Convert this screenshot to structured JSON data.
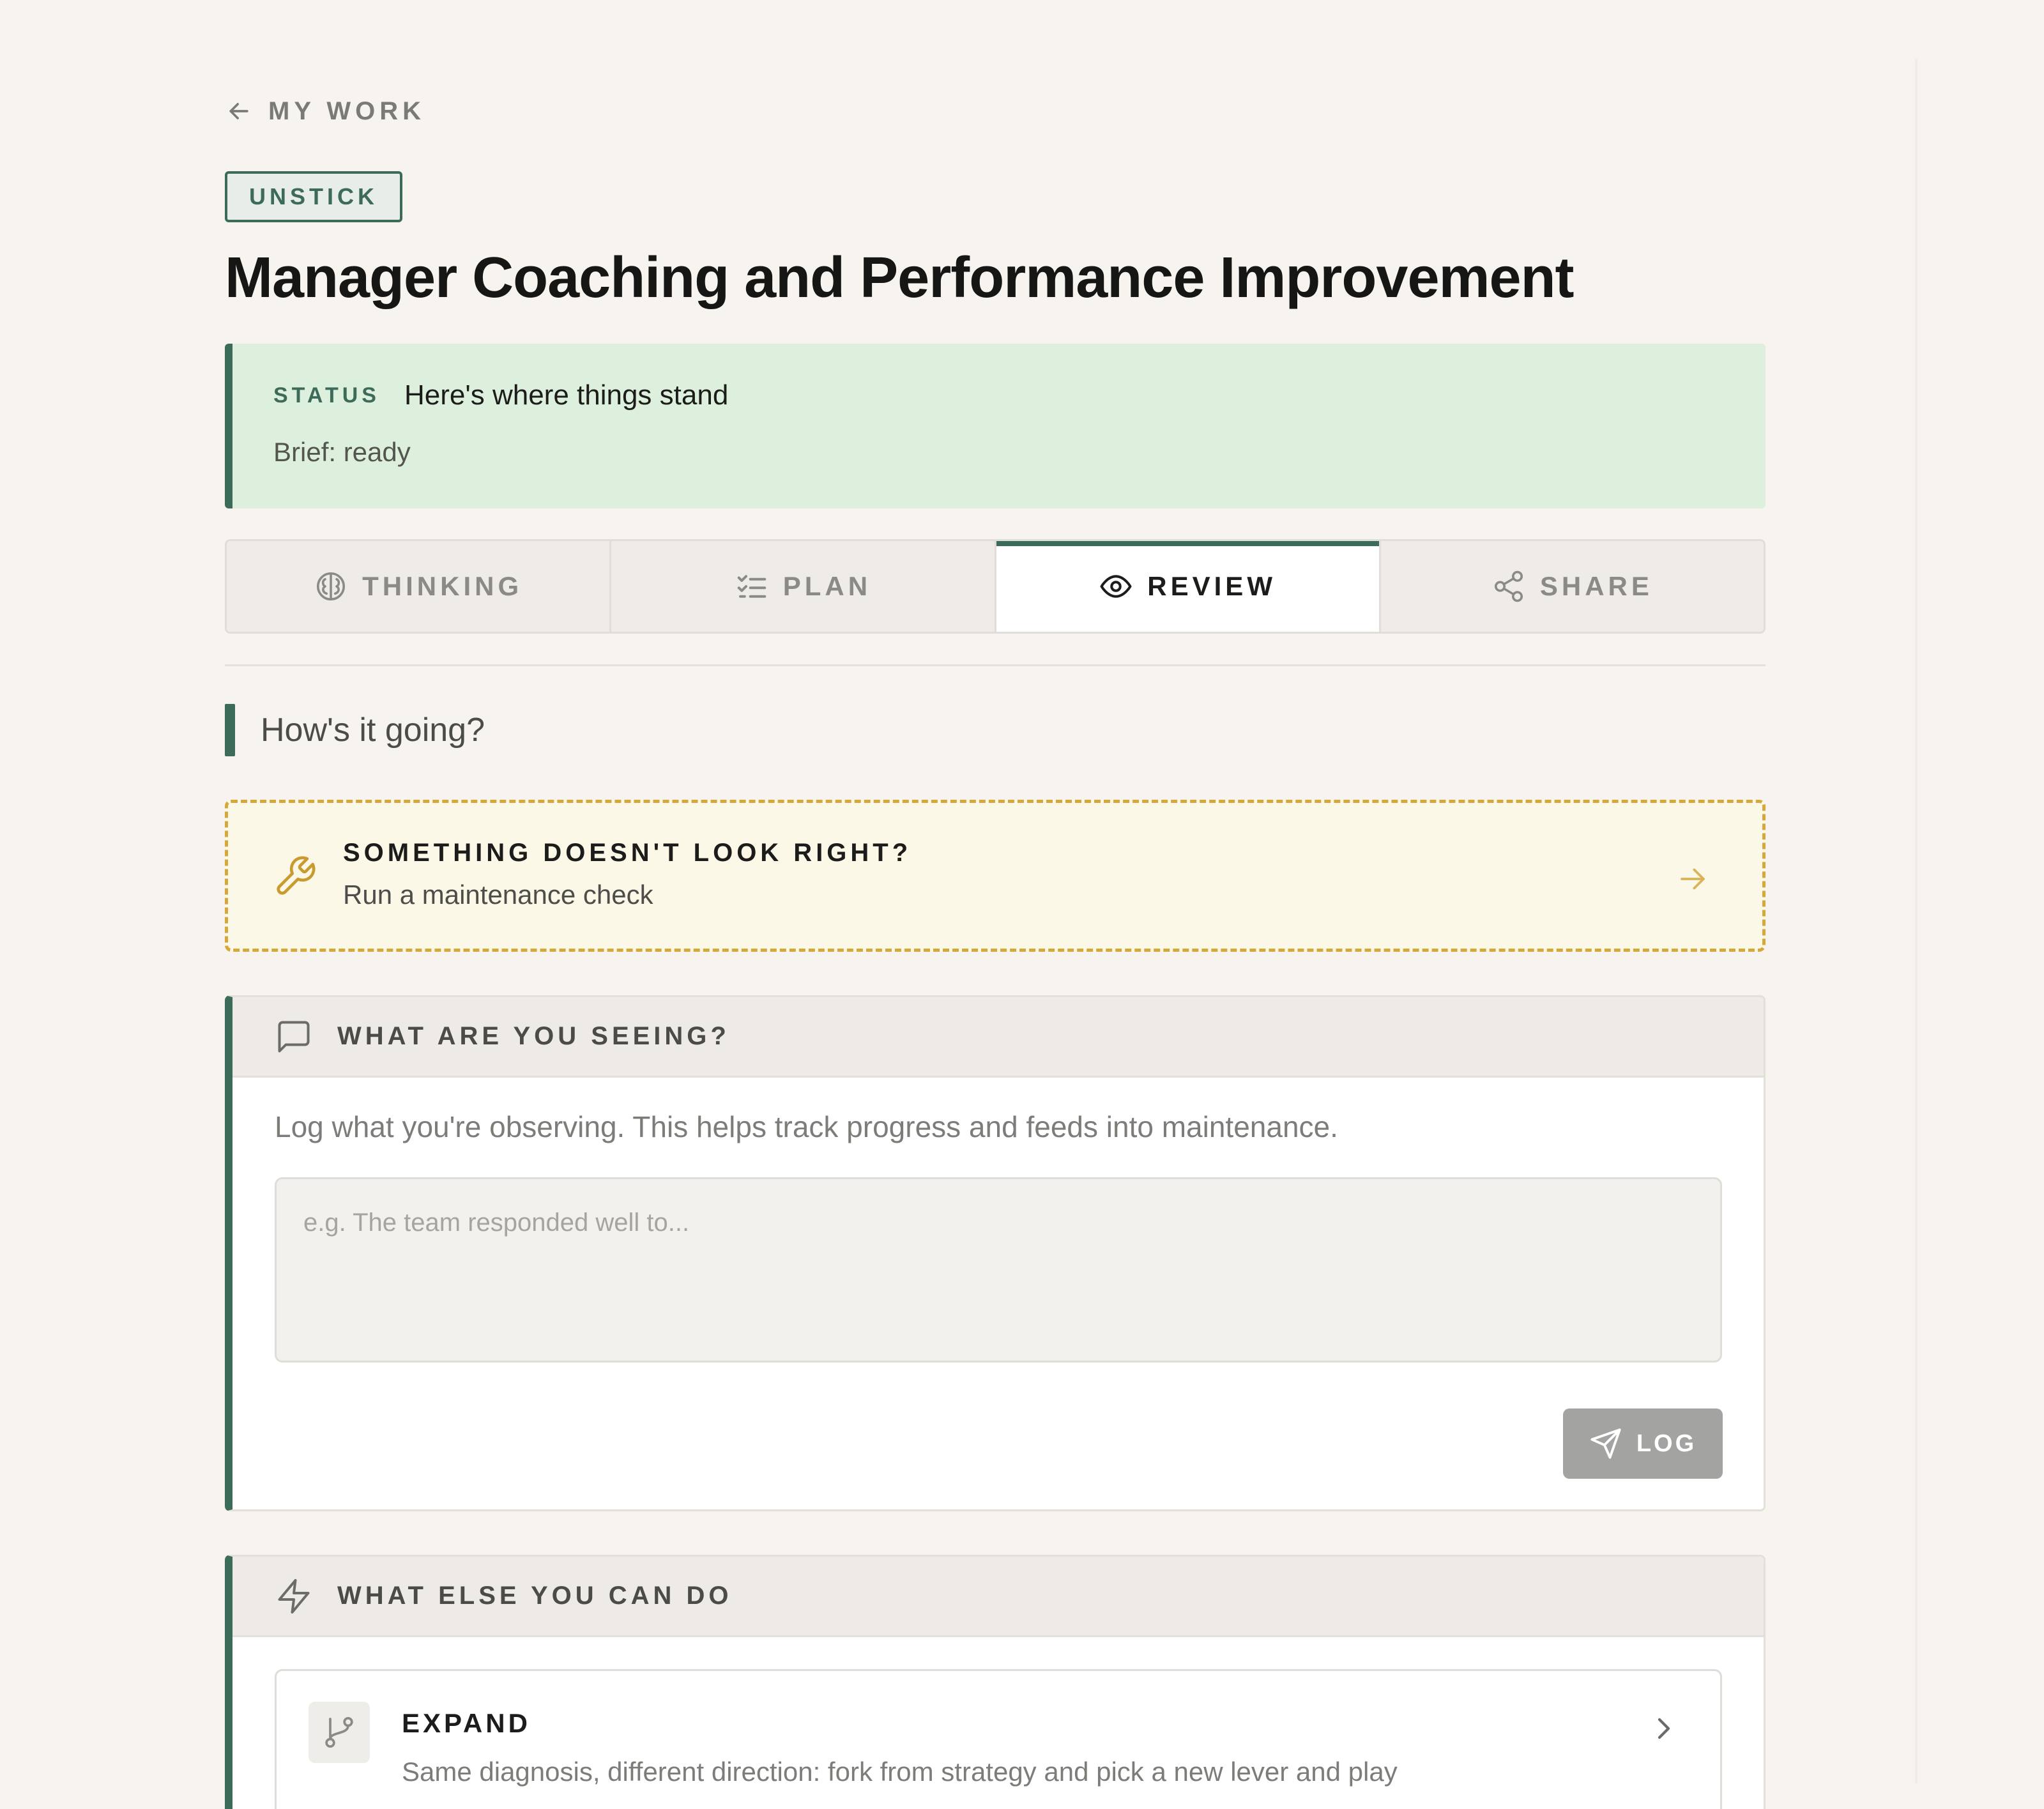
{
  "nav": {
    "back_label": "MY WORK"
  },
  "tag": "UNSTICK",
  "title": "Manager Coaching and Performance Improvement",
  "status": {
    "label": "STATUS",
    "headline": "Here's where things stand",
    "brief": "Brief: ready"
  },
  "tabs": [
    {
      "label": "THINKING",
      "icon": "brain-icon",
      "active": false
    },
    {
      "label": "PLAN",
      "icon": "checklist-icon",
      "active": false
    },
    {
      "label": "REVIEW",
      "icon": "eye-icon",
      "active": true
    },
    {
      "label": "SHARE",
      "icon": "share-icon",
      "active": false
    }
  ],
  "section": {
    "heading": "How's it going?"
  },
  "maintenance": {
    "title": "SOMETHING DOESN'T LOOK RIGHT?",
    "subtitle": "Run a maintenance check",
    "icon": "wrench-icon"
  },
  "observe": {
    "title": "WHAT ARE YOU SEEING?",
    "icon": "chat-icon",
    "description": "Log what you're observing. This helps track progress and feeds into maintenance.",
    "input_placeholder": "e.g. The team responded well to...",
    "input_value": "",
    "log_label": "LOG"
  },
  "more": {
    "title": "WHAT ELSE YOU CAN DO",
    "icon": "lightning-icon",
    "items": [
      {
        "title": "EXPAND",
        "icon": "fork-icon",
        "description": "Same diagnosis, different direction: fork from strategy and pick a new lever and play"
      }
    ]
  },
  "colors": {
    "accent": "#3d6b5a",
    "background": "#f7f4f0",
    "status_bg": "#dcf0dd",
    "warning_border": "#d4a83a",
    "warning_bg": "#fcf8e8",
    "button_disabled": "#a3a3a1"
  }
}
